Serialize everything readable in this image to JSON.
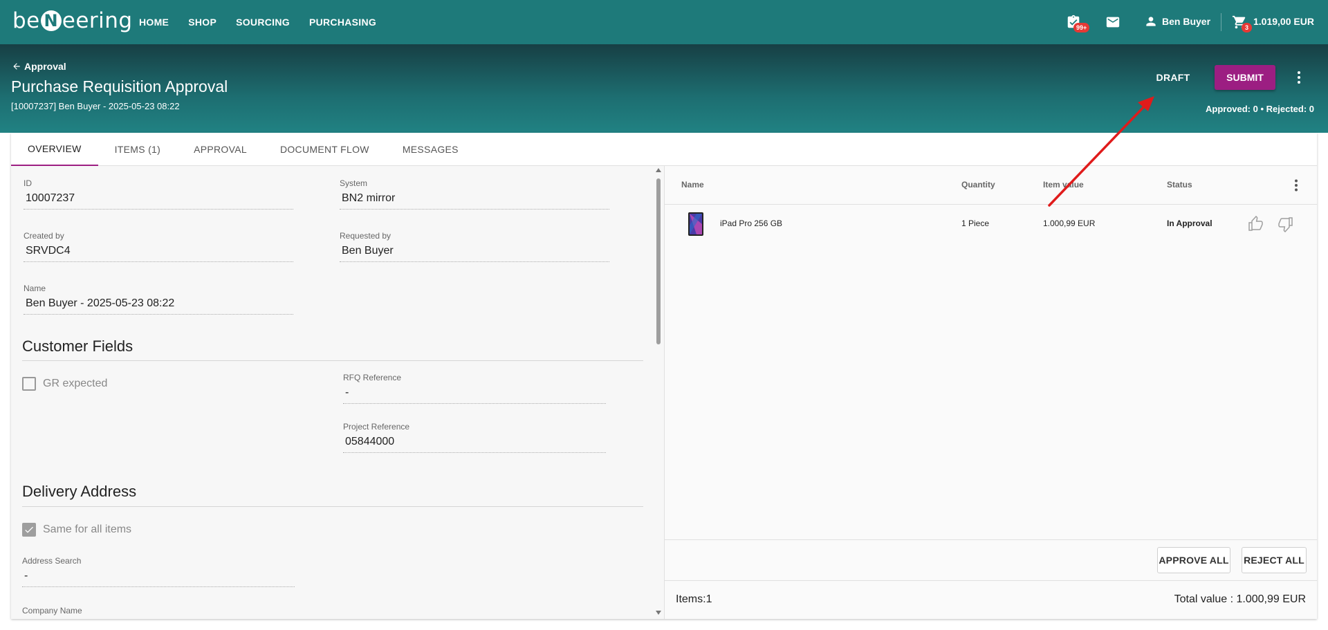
{
  "brand": {
    "logo_left": "be",
    "logo_n": "N",
    "logo_right": "eering"
  },
  "nav": {
    "items": [
      "HOME",
      "SHOP",
      "SOURCING",
      "PURCHASING"
    ]
  },
  "topbar": {
    "tasks_badge": "99+",
    "user_name": "Ben Buyer",
    "cart_badge": "3",
    "cart_total": "1.019,00 EUR"
  },
  "header": {
    "back_label": "Approval",
    "title": "Purchase Requisition Approval",
    "subtitle": "[10007237] Ben Buyer - 2025-05-23 08:22",
    "draft_label": "DRAFT",
    "submit_label": "SUBMIT",
    "approval_counts": "Approved: 0 • Rejected: 0"
  },
  "tabs": [
    "OVERVIEW",
    "ITEMS (1)",
    "APPROVAL",
    "DOCUMENT FLOW",
    "MESSAGES"
  ],
  "overview": {
    "id_label": "ID",
    "id_value": "10007237",
    "system_label": "System",
    "system_value": "BN2 mirror",
    "created_by_label": "Created by",
    "created_by_value": "SRVDC4",
    "requested_by_label": "Requested by",
    "requested_by_value": "Ben Buyer",
    "name_label": "Name",
    "name_value": "Ben Buyer - 2025-05-23 08:22",
    "customer_fields_title": "Customer Fields",
    "gr_expected_label": "GR expected",
    "rfq_label": "RFQ Reference",
    "rfq_value": "-",
    "project_label": "Project Reference",
    "project_value": "05844000",
    "delivery_title": "Delivery Address",
    "same_for_all_label": "Same for all items",
    "address_search_label": "Address Search",
    "address_search_value": "-",
    "company_name_label": "Company Name"
  },
  "items_table": {
    "columns": [
      "Name",
      "Quantity",
      "Item value",
      "Status"
    ],
    "rows": [
      {
        "name": "iPad Pro 256 GB",
        "quantity": "1 Piece",
        "value": "1.000,99 EUR",
        "status": "In Approval"
      }
    ],
    "approve_all": "APPROVE ALL",
    "reject_all": "REJECT ALL",
    "items_count": "Items:1",
    "total_value": "Total value : 1.000,99 EUR"
  },
  "colors": {
    "primary": "#1e7a7a",
    "accent": "#9c1e82",
    "badge": "#e53935",
    "annotation_arrow": "#e01b1b"
  }
}
